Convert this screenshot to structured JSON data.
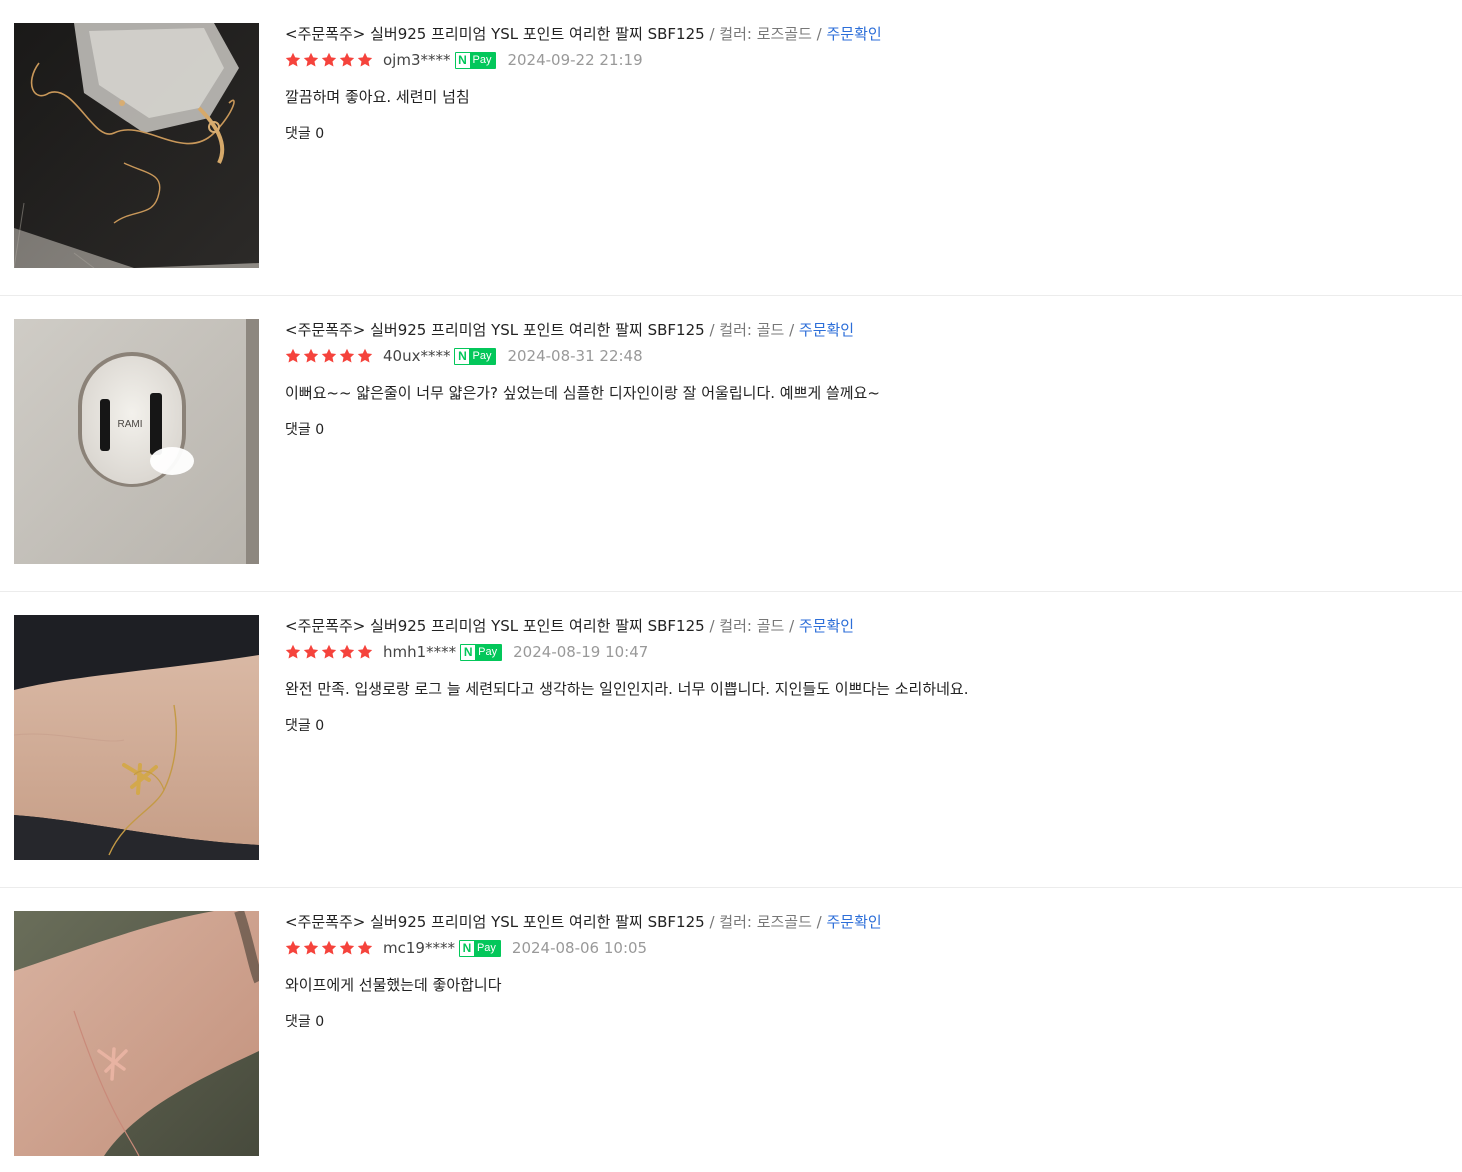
{
  "reviews": [
    {
      "product_name": "<주문폭주> 실버925 프리미엄 YSL 포인트 여리한 팔찌 SBF125",
      "separator": " / ",
      "option": "컬러: 로즈골드",
      "status": "주문확인",
      "rating": 5,
      "user_id": "ojm3****",
      "pay_badge_n": "N",
      "pay_badge_text": "Pay",
      "date": "2024-09-22 21:19",
      "text": "깔끔하며 좋아요. 세련미 넘침",
      "comments": "댓글 0",
      "photo": "bracelet-in-plastic-bag-on-black-box"
    },
    {
      "product_name": "<주문폭주> 실버925 프리미엄 YSL 포인트 여리한 팔찌 SBF125",
      "separator": " / ",
      "option": "컬러: 골드",
      "status": "주문확인",
      "rating": 5,
      "user_id": "40ux****",
      "pay_badge_n": "N",
      "pay_badge_text": "Pay",
      "date": "2024-08-31 22:48",
      "text": "이뻐요~~ 얇은줄이 너무 얇은가? 싶었는데 심플한 디자인이랑 잘 어울립니다. 예쁘게 쓸께요~",
      "comments": "댓글 0",
      "photo": "jewelry-box-with-rami-logo",
      "photo_label": "RAMI"
    },
    {
      "product_name": "<주문폭주> 실버925 프리미엄 YSL 포인트 여리한 팔찌 SBF125",
      "separator": " / ",
      "option": "컬러: 골드",
      "status": "주문확인",
      "rating": 5,
      "user_id": "hmh1****",
      "pay_badge_n": "N",
      "pay_badge_text": "Pay",
      "date": "2024-08-19 10:47",
      "text": "완전 만족. 입생로랑 로그 늘 세련되다고 생각하는 일인인지라. 너무 이쁩니다. 지인들도 이쁘다는 소리하네요.",
      "comments": "댓글 0",
      "photo": "gold-bracelet-on-wrist"
    },
    {
      "product_name": "<주문폭주> 실버925 프리미엄 YSL 포인트 여리한 팔찌 SBF125",
      "separator": " / ",
      "option": "컬러: 로즈골드",
      "status": "주문확인",
      "rating": 5,
      "user_id": "mc19****",
      "pay_badge_n": "N",
      "pay_badge_text": "Pay",
      "date": "2024-08-06 10:05",
      "text": "와이프에게 선물했는데 좋아합니다",
      "comments": "댓글 0",
      "photo": "rose-gold-bracelet-on-wrist"
    }
  ],
  "colors": {
    "star": "#f5433c",
    "status_link": "#2c6ed8",
    "npay_green": "#03c75a",
    "muted": "#999999"
  }
}
